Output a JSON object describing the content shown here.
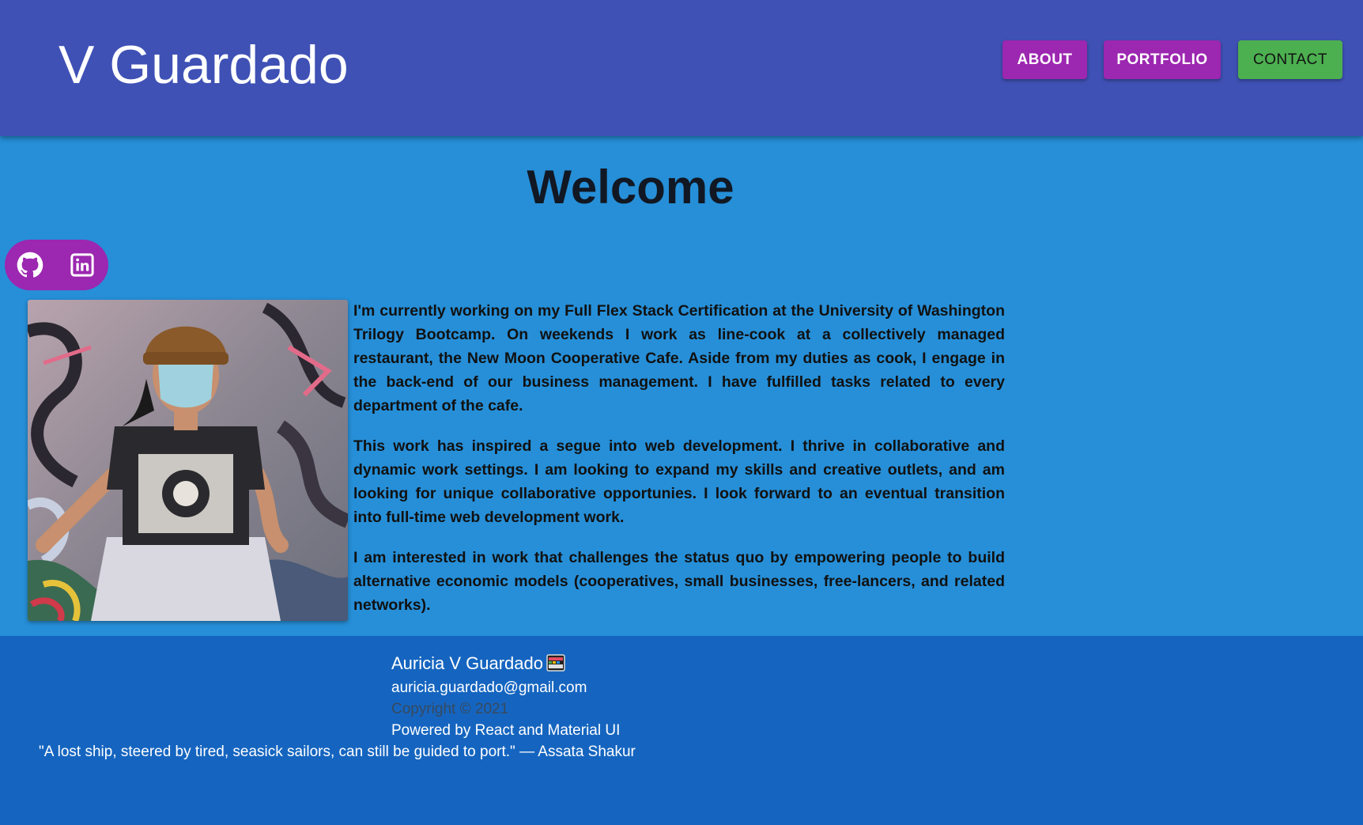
{
  "header": {
    "title": "V Guardado",
    "nav": {
      "about": "ABOUT",
      "portfolio": "PORTFOLIO",
      "contact": "CONTACT"
    }
  },
  "main": {
    "heading": "Welcome",
    "social": [
      {
        "icon": "github-icon"
      },
      {
        "icon": "linkedin-icon"
      }
    ],
    "bio": [
      "I'm currently working on my Full Flex Stack Certification at the University of Washington Trilogy Bootcamp. On weekends I work as line-cook at a collectively managed restaurant, the New Moon Cooperative Cafe. Aside from my duties as cook, I engage in the back-end of our business management. I have fulfilled tasks related to every department of the cafe.",
      "This work has inspired a segue into web development. I thrive in collaborative and dynamic work settings. I am looking to expand my skills and creative outlets, and am looking for unique collaborative opportunies. I look forward to an eventual transition into full-time web development work.",
      "I am interested in work that challenges the status quo by empowering people to build alternative economic models (cooperatives, small businesses, free-lancers, and related networks)."
    ]
  },
  "footer": {
    "name": "Auricia V Guardado",
    "email": "auricia.guardado@gmail.com",
    "copyright": "Copyright © 2021",
    "powered": "Powered by React and Material UI",
    "quote": "\"A lost ship, steered by tired, seasick sailors, can still be guided to port.\" — Assata Shakur"
  },
  "colors": {
    "header_bg": "#3f51b5",
    "main_bg": "#268fd8",
    "footer_bg": "#1565c0",
    "purple_button": "#9c27b0",
    "green_button": "#4caf50"
  }
}
